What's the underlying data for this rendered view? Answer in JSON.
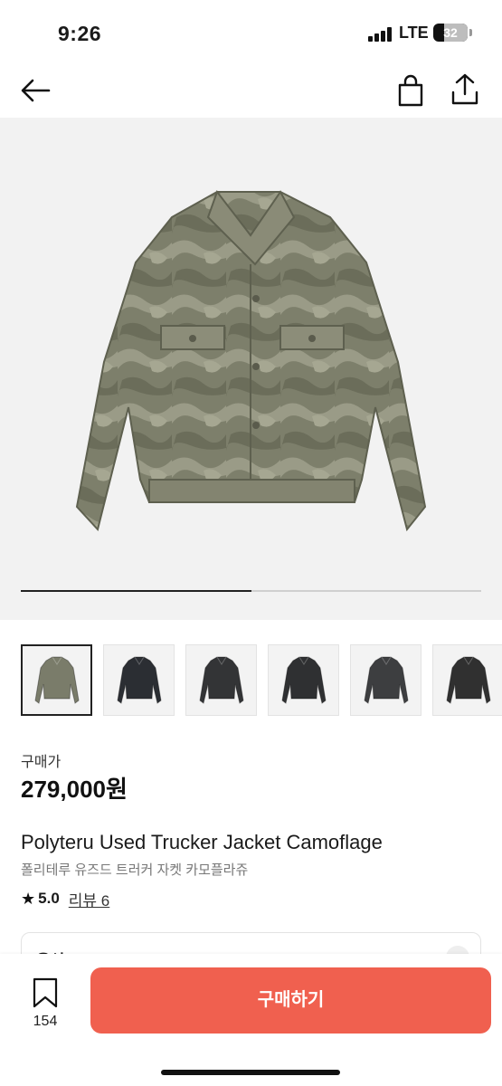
{
  "status_bar": {
    "time": "9:26",
    "network": "LTE",
    "battery": "32",
    "battery_fraction": 0.32
  },
  "nav": {
    "back_icon": "arrow-left-icon",
    "bag_icon": "shopping-bag-icon",
    "share_icon": "share-icon"
  },
  "gallery": {
    "progress_fraction": 0.5,
    "thumbnails": [
      {
        "name": "camo",
        "color": "#7a7c6a",
        "selected": true
      },
      {
        "name": "black-1",
        "color": "#2b2e33"
      },
      {
        "name": "black-2",
        "color": "#333436"
      },
      {
        "name": "black-3",
        "color": "#2f3032"
      },
      {
        "name": "charcoal",
        "color": "#3d3e40"
      },
      {
        "name": "black-4",
        "color": "#303030"
      }
    ]
  },
  "product": {
    "price_label": "구매가",
    "price": "279,000원",
    "title": "Polyteru Used Trucker Jacket Camoflage",
    "subtitle": "폴리테루 유즈드 트러커 자켓 카모플라쥬",
    "rating": "5.0",
    "reviews": "리뷰 6"
  },
  "options": {
    "label": "옵션"
  },
  "bottom_bar": {
    "wishlist_count": "154",
    "buy_label": "구매하기",
    "buy_color": "#f0604f"
  }
}
